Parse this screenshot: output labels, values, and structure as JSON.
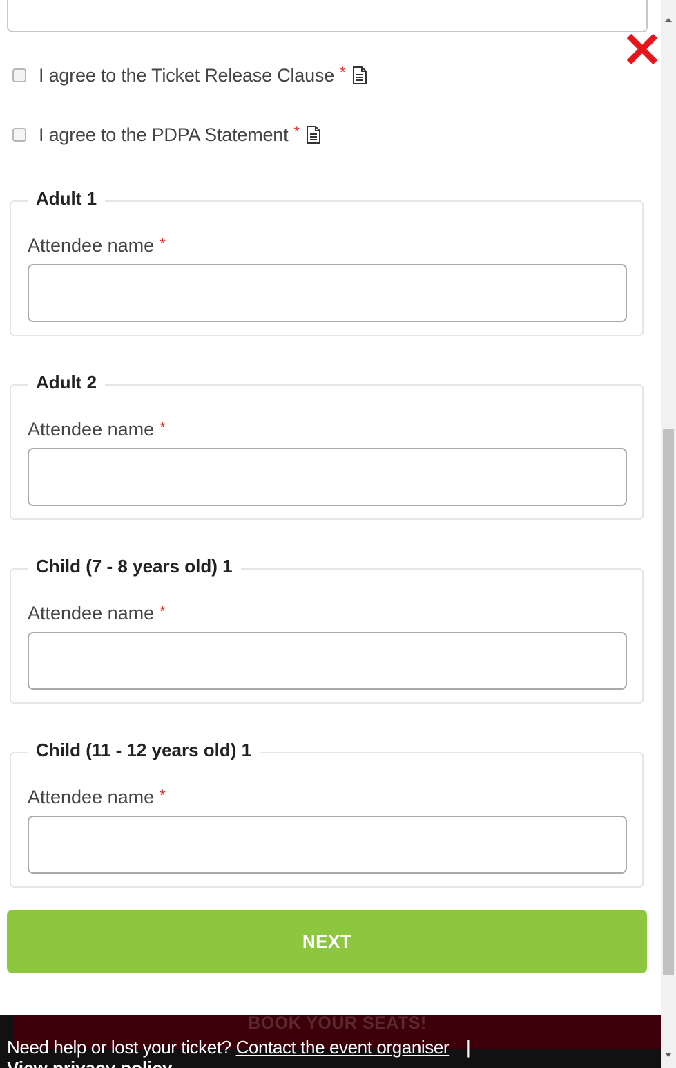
{
  "agreements": [
    {
      "label": "I agree to the Ticket Release Clause",
      "required": "*"
    },
    {
      "label": "I agree to the PDPA Statement",
      "required": "*"
    }
  ],
  "attendees": [
    {
      "title": "Adult 1",
      "field_label": "Attendee name",
      "required": "*",
      "value": ""
    },
    {
      "title": "Adult 2",
      "field_label": "Attendee name",
      "required": "*",
      "value": ""
    },
    {
      "title": "Child (7 - 8 years old) 1",
      "field_label": "Attendee name",
      "required": "*",
      "value": ""
    },
    {
      "title": "Child (11 - 12 years old) 1",
      "field_label": "Attendee name",
      "required": "*",
      "value": ""
    }
  ],
  "next_button": "NEXT",
  "footer": {
    "banner": "BOOK YOUR SEATS!",
    "help_text": "Need help or lost your ticket?",
    "contact_link": "Contact the event organiser",
    "separator": "|",
    "privacy_link": "View privacy policy"
  },
  "colors": {
    "accent": "#8dc63f",
    "required": "#e0302a",
    "close": "#e8141c",
    "banner": "#3d0008"
  }
}
